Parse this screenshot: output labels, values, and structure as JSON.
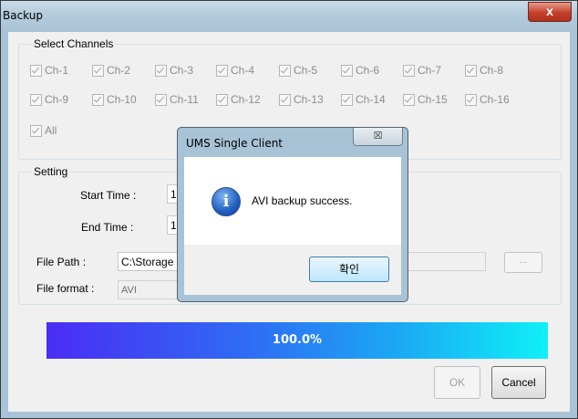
{
  "window": {
    "title": "Backup",
    "close_label": "x"
  },
  "channels": {
    "group_title": "Select Channels",
    "row1": [
      "Ch-1",
      "Ch-2",
      "Ch-3",
      "Ch-4",
      "Ch-5",
      "Ch-6",
      "Ch-7",
      "Ch-8"
    ],
    "row2": [
      "Ch-9",
      "Ch-10",
      "Ch-11",
      "Ch-12",
      "Ch-13",
      "Ch-14",
      "Ch-15",
      "Ch-16"
    ],
    "all_label": "All"
  },
  "setting": {
    "group_title": "Setting",
    "start_time_label": "Start Time :",
    "start_time_value": "1",
    "end_time_label": "End Time  :",
    "end_time_value": "1",
    "file_path_label": "File Path :",
    "file_path_value": "C:\\Storage",
    "browse_label": "...",
    "file_format_label": "File format :",
    "file_format_value": "AVI"
  },
  "progress": {
    "percent": 100.0,
    "label": "100.0%"
  },
  "buttons": {
    "ok": "OK",
    "cancel": "Cancel"
  },
  "dialog": {
    "title": "UMS Single Client",
    "close_label": "☒",
    "message": "AVI backup success.",
    "confirm": "확인"
  }
}
